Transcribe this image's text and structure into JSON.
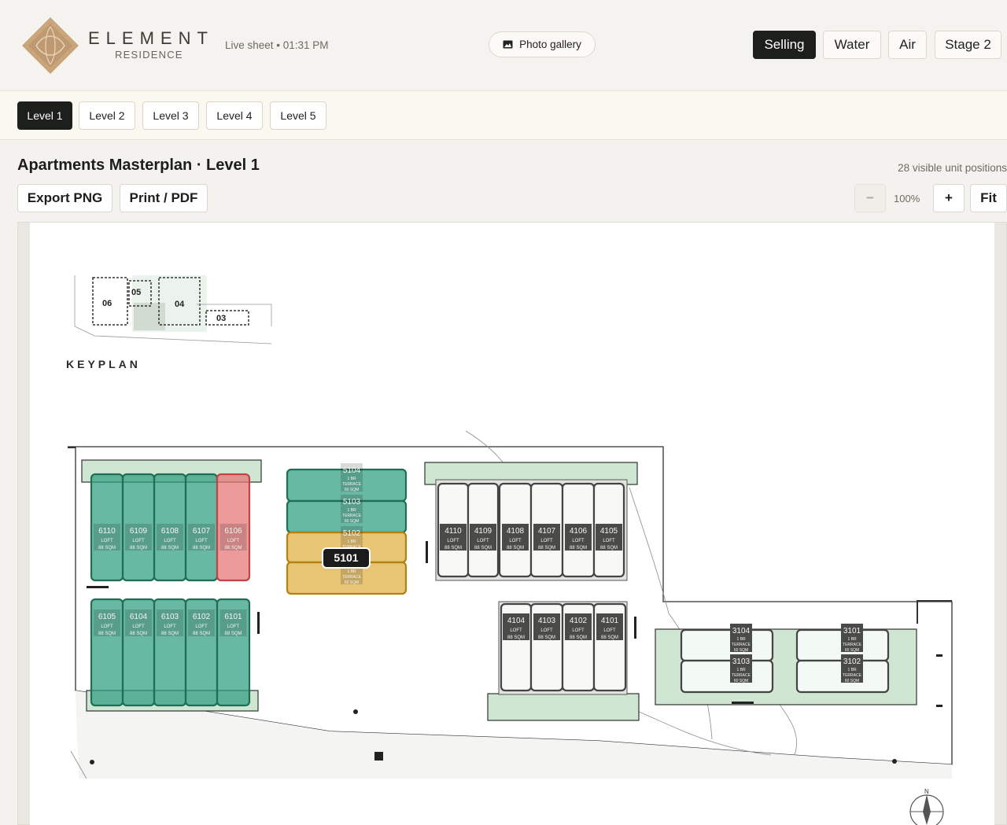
{
  "brand": {
    "name": "ELEMENT",
    "sub": "RESIDENCE"
  },
  "status": {
    "live": "Live sheet • 01:31 PM"
  },
  "gallery": {
    "label": "Photo gallery"
  },
  "modes": [
    "Selling",
    "Water",
    "Air",
    "Stage 2"
  ],
  "levels": [
    "Level 1",
    "Level 2",
    "Level 3",
    "Level 4",
    "Level 5"
  ],
  "page": {
    "title": "Apartments Masterplan · Level 1",
    "count": "28 visible unit positions"
  },
  "actions": {
    "export": "Export PNG",
    "print": "Print / PDF"
  },
  "zoom": {
    "minus": "−",
    "value": "100%",
    "plus": "+",
    "fit": "Fit"
  },
  "keyplan": {
    "label": "KEYPLAN",
    "blocks": [
      "06",
      "05",
      "04",
      "03"
    ]
  },
  "compass": {
    "north": "N"
  },
  "colors": {
    "available": "#2e9e7f",
    "reserved": "#e08080",
    "hold": "#d8a93a",
    "unreleased": "#d9d9d9"
  },
  "callout": "5101",
  "units": [
    {
      "id": "6110",
      "l1": "LOFT",
      "l2": "88 SQM",
      "status": "available"
    },
    {
      "id": "6109",
      "l1": "LOFT",
      "l2": "88 SQM",
      "status": "available"
    },
    {
      "id": "6108",
      "l1": "LOFT",
      "l2": "88 SQM",
      "status": "available"
    },
    {
      "id": "6107",
      "l1": "LOFT",
      "l2": "88 SQM",
      "status": "available"
    },
    {
      "id": "6106",
      "l1": "LOFT",
      "l2": "88 SQM",
      "status": "reserved"
    },
    {
      "id": "6105",
      "l1": "LOFT",
      "l2": "88 SQM",
      "status": "available"
    },
    {
      "id": "6104",
      "l1": "LOFT",
      "l2": "88 SQM",
      "status": "available"
    },
    {
      "id": "6103",
      "l1": "LOFT",
      "l2": "88 SQM",
      "status": "available"
    },
    {
      "id": "6102",
      "l1": "LOFT",
      "l2": "88 SQM",
      "status": "available"
    },
    {
      "id": "6101",
      "l1": "LOFT",
      "l2": "88 SQM",
      "status": "available"
    },
    {
      "id": "5104",
      "l1": "1 BR",
      "l2": "TERRACE",
      "l3": "60 SQM",
      "status": "available"
    },
    {
      "id": "5103",
      "l1": "1 BR",
      "l2": "TERRACE",
      "l3": "60 SQM",
      "status": "available"
    },
    {
      "id": "5102",
      "l1": "1 BR",
      "l2": "TERRACE",
      "l3": "60 SQM",
      "status": "hold"
    },
    {
      "id": "5101",
      "l1": "1 BR",
      "l2": "TERRACE",
      "l3": "60 SQM",
      "status": "hold"
    },
    {
      "id": "4110",
      "l1": "LOFT",
      "l2": "88 SQM",
      "status": "unreleased"
    },
    {
      "id": "4109",
      "l1": "LOFT",
      "l2": "88 SQM",
      "status": "unreleased"
    },
    {
      "id": "4108",
      "l1": "LOFT",
      "l2": "88 SQM",
      "status": "unreleased"
    },
    {
      "id": "4107",
      "l1": "LOFT",
      "l2": "88 SQM",
      "status": "unreleased"
    },
    {
      "id": "4106",
      "l1": "LOFT",
      "l2": "88 SQM",
      "status": "unreleased"
    },
    {
      "id": "4105",
      "l1": "LOFT",
      "l2": "88 SQM",
      "status": "unreleased"
    },
    {
      "id": "4104",
      "l1": "LOFT",
      "l2": "88 SQM",
      "status": "unreleased"
    },
    {
      "id": "4103",
      "l1": "LOFT",
      "l2": "88 SQM",
      "status": "unreleased"
    },
    {
      "id": "4102",
      "l1": "LOFT",
      "l2": "88 SQM",
      "status": "unreleased"
    },
    {
      "id": "4101",
      "l1": "LOFT",
      "l2": "88 SQM",
      "status": "unreleased"
    },
    {
      "id": "3104",
      "l1": "1 BR",
      "l2": "TERRACE",
      "l3": "60 SQM",
      "status": "unreleased"
    },
    {
      "id": "3103",
      "l1": "1 BR",
      "l2": "TERRACE",
      "l3": "60 SQM",
      "status": "unreleased"
    },
    {
      "id": "3101",
      "l1": "1 BR",
      "l2": "TERRACE",
      "l3": "60 SQM",
      "status": "unreleased"
    },
    {
      "id": "3102",
      "l1": "1 BR",
      "l2": "TERRACE",
      "l3": "60 SQM",
      "status": "unreleased"
    }
  ]
}
